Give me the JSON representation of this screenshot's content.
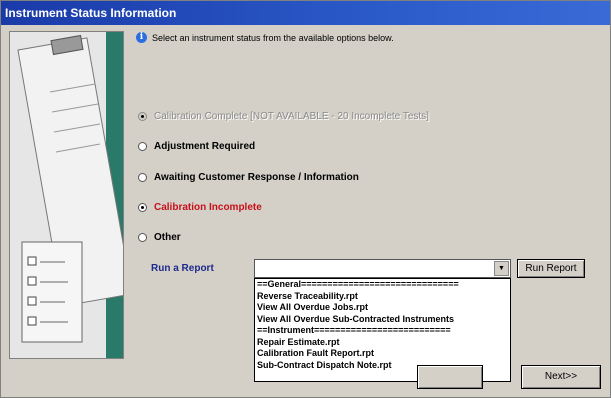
{
  "window": {
    "title": "Instrument Status Information"
  },
  "instruction": "Select an instrument status from the available options below.",
  "options": [
    {
      "label": "Calibration Complete [NOT AVAILABLE - 20 Incomplete Tests]",
      "selected": true,
      "disabled": true
    },
    {
      "label": "Adjustment Required",
      "selected": false,
      "disabled": false
    },
    {
      "label": "Awaiting Customer Response / Information",
      "selected": false,
      "disabled": false
    },
    {
      "label": "Calibration Incomplete",
      "selected": true,
      "disabled": false,
      "color": "#c8101a"
    },
    {
      "label": "Other",
      "selected": false,
      "disabled": false
    }
  ],
  "report": {
    "label": "Run a Report",
    "selected_value": "",
    "run_button": "Run Report",
    "items": [
      "==General==============================",
      "Reverse Traceability.rpt",
      "View All Overdue Jobs.rpt",
      "View All Overdue Sub-Contracted Instruments",
      "==Instrument==========================",
      "Repair Estimate.rpt",
      "Calibration Fault Report.rpt",
      "Sub-Contract Dispatch Note.rpt"
    ]
  },
  "nav": {
    "back_label": "",
    "next_label": "Next>>"
  },
  "colors": {
    "title_bar": "#1a3aa8",
    "report_label": "#1c2a8a",
    "incomplete": "#c8101a"
  }
}
